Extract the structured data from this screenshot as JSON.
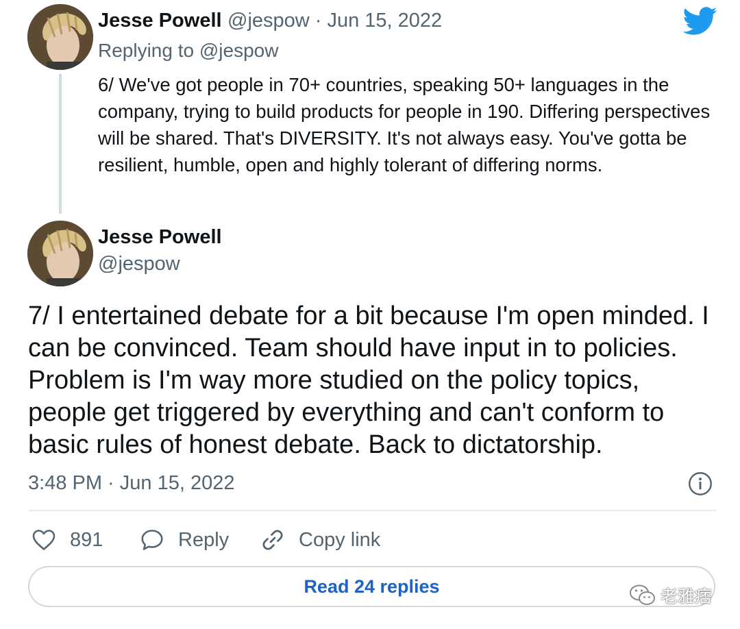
{
  "quoted_tweet": {
    "author_name": "Jesse Powell",
    "handle_date": "@jespow · Jun 15, 2022",
    "replying_to": "Replying to @jespow",
    "text": "6/ We've got people in 70+ countries, speaking 50+ languages in the company, trying to build products for people in 190. Differing perspectives will be shared. That's DIVERSITY. It's not always easy. You've gotta be resilient, humble, open and highly tolerant of differing norms."
  },
  "main_tweet": {
    "author_name": "Jesse Powell",
    "handle": "@jespow",
    "text": "7/ I entertained debate for a bit because I'm open minded. I can be convinced. Team should have input in to policies. Problem is I'm way more studied on the policy topics, people get triggered by everything and can't conform to basic rules of honest debate. Back to dictatorship.",
    "timestamp": "3:48 PM · Jun 15, 2022"
  },
  "actions": {
    "like_count": "891",
    "reply_label": "Reply",
    "copy_link_label": "Copy link"
  },
  "read_replies_label": "Read 24 replies",
  "watermark_text": "老雅痞",
  "icons": {
    "logo": "twitter-bird-icon",
    "info": "info-icon",
    "like": "heart-icon",
    "reply": "speech-bubble-icon",
    "copy": "link-icon",
    "watermark": "wechat-icon"
  },
  "colors": {
    "twitter_blue": "#1d9bf0",
    "link_blue": "#1d62c9",
    "secondary_text": "#536471",
    "thread_line": "#cfd9de"
  }
}
